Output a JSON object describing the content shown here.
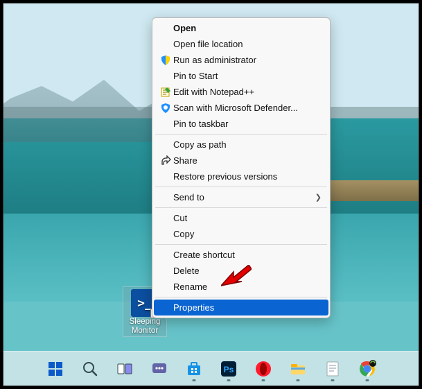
{
  "desktop": {
    "icon_label_line1": "Sleeping",
    "icon_label_line2": "Monitor"
  },
  "context_menu": {
    "items": [
      {
        "label": "Open",
        "bold": true,
        "icon": null
      },
      {
        "label": "Open file location",
        "icon": null
      },
      {
        "label": "Run as administrator",
        "icon": "shield"
      },
      {
        "label": "Pin to Start",
        "icon": null
      },
      {
        "label": "Edit with Notepad++",
        "icon": "notepad"
      },
      {
        "label": "Scan with Microsoft Defender...",
        "icon": "defender"
      },
      {
        "label": "Pin to taskbar",
        "icon": null
      },
      {
        "sep": true
      },
      {
        "label": "Copy as path",
        "icon": null
      },
      {
        "label": "Share",
        "icon": "share"
      },
      {
        "label": "Restore previous versions",
        "icon": null
      },
      {
        "sep": true
      },
      {
        "label": "Send to",
        "icon": null,
        "submenu": true
      },
      {
        "sep": true
      },
      {
        "label": "Cut",
        "icon": null
      },
      {
        "label": "Copy",
        "icon": null
      },
      {
        "sep": true
      },
      {
        "label": "Create shortcut",
        "icon": null
      },
      {
        "label": "Delete",
        "icon": null
      },
      {
        "label": "Rename",
        "icon": null
      },
      {
        "sep": true
      },
      {
        "label": "Properties",
        "icon": null,
        "highlight": true
      }
    ]
  },
  "taskbar": {
    "items": [
      {
        "name": "start"
      },
      {
        "name": "search"
      },
      {
        "name": "task-view"
      },
      {
        "name": "chat"
      },
      {
        "name": "store"
      },
      {
        "name": "photoshop"
      },
      {
        "name": "opera"
      },
      {
        "name": "explorer"
      },
      {
        "name": "notepad"
      },
      {
        "name": "chrome"
      }
    ]
  }
}
